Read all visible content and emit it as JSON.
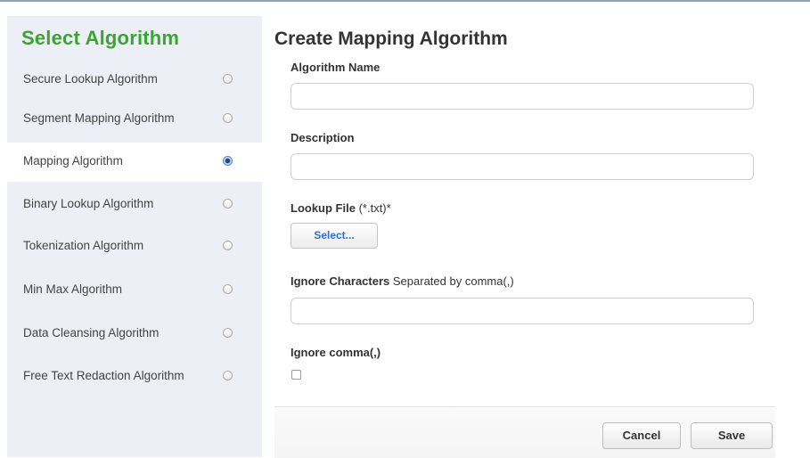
{
  "sidebar": {
    "title": "Select Algorithm",
    "items": [
      {
        "label": "Secure Lookup Algorithm",
        "selected": false
      },
      {
        "label": "Segment Mapping Algorithm",
        "selected": false
      },
      {
        "label": "Mapping Algorithm",
        "selected": true
      },
      {
        "label": "Binary Lookup Algorithm",
        "selected": false
      },
      {
        "label": "Tokenization Algorithm",
        "selected": false
      },
      {
        "label": "Min Max Algorithm",
        "selected": false
      },
      {
        "label": "Data Cleansing Algorithm",
        "selected": false
      },
      {
        "label": "Free Text Redaction Algorithm",
        "selected": false
      }
    ]
  },
  "form": {
    "title": "Create Mapping Algorithm",
    "algorithm_name": {
      "label": "Algorithm Name",
      "value": ""
    },
    "description": {
      "label": "Description",
      "value": ""
    },
    "lookup_file": {
      "label": "Lookup File",
      "hint": "(*.txt)*",
      "button_label": "Select..."
    },
    "ignore_characters": {
      "label": "Ignore Characters",
      "hint": "Separated by comma(,)",
      "value": ""
    },
    "ignore_comma": {
      "label": "Ignore comma(,)",
      "checked": false
    }
  },
  "actions": {
    "cancel_label": "Cancel",
    "save_label": "Save"
  },
  "colors": {
    "sidebar_title": "#3aa52f",
    "sidebar_bg": "#eceff5",
    "select_button_text": "#2f6fcf",
    "radio_selected": "#1f4b8e"
  }
}
